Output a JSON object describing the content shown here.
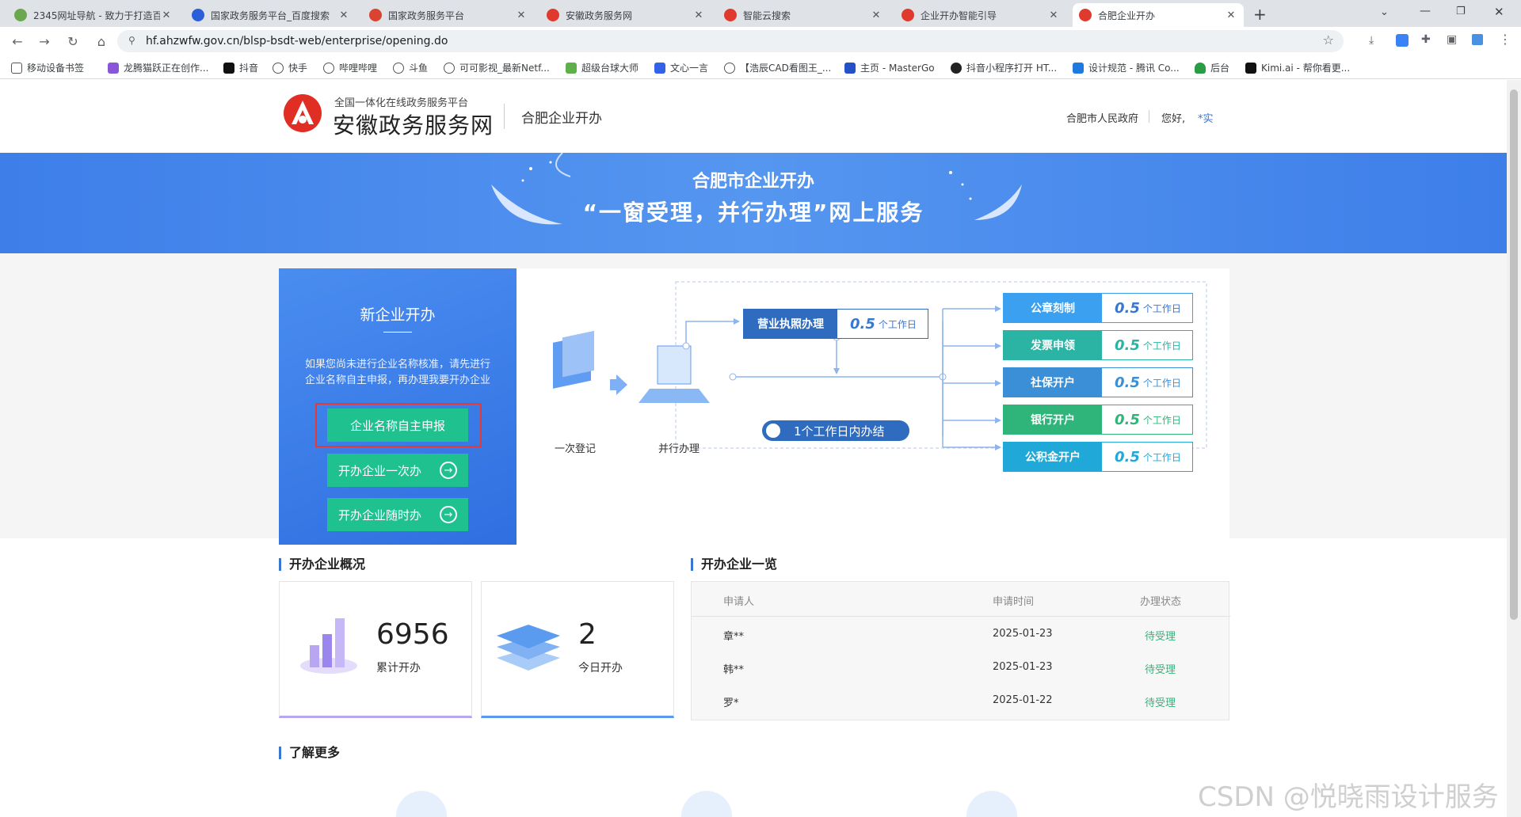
{
  "browser": {
    "tabs": [
      {
        "title": "2345网址导航 - 致力于打造百",
        "color": "#6aa84f"
      },
      {
        "title": "国家政务服务平台_百度搜索",
        "color": "#2b5fd9"
      },
      {
        "title": "国家政务服务平台",
        "color": "#d9432f"
      },
      {
        "title": "安徽政务服务网",
        "color": "#e03a2f"
      },
      {
        "title": "智能云搜索",
        "color": "#e03a2f"
      },
      {
        "title": "企业开办智能引导",
        "color": "#e03a2f"
      },
      {
        "title": "合肥企业开办",
        "color": "#e03a2f"
      }
    ],
    "url": "hf.ahzwfw.gov.cn/blsp-bsdt-web/enterprise/opening.do",
    "bookmarks": [
      "移动设备书签",
      "龙腾猫跃正在创作...",
      "抖音",
      "快手",
      "哔哩哔哩",
      "斗鱼",
      "可可影视_最新Netf...",
      "超级台球大师",
      "文心一言",
      "【浩辰CAD看图王_...",
      "主页 - MasterGo",
      "抖音小程序打开 HT...",
      "设计规范 - 腾讯 Co...",
      "后台",
      "Kimi.ai - 帮你看更..."
    ]
  },
  "header": {
    "logo_sub": "全国一体化在线政务服务平台",
    "logo_main": "安徽政务服务网",
    "site_name": "合肥企业开办",
    "gov_link": "合肥市人民政府",
    "greeting": "您好,",
    "user": "*实"
  },
  "banner": {
    "line1": "合肥市企业开办",
    "line2": "“一窗受理，并行办理”网上服务"
  },
  "panel": {
    "title": "新企业开办",
    "desc1": "如果您尚未进行企业名称核准，请先进行",
    "desc2": "企业名称自主申报，再办理我要开办企业",
    "btn_name": "企业名称自主申报",
    "btn_once": "开办企业一次办",
    "btn_anytime": "开办企业随时办"
  },
  "flow": {
    "step1": "一次登记",
    "step2": "并行办理",
    "license": {
      "label": "营业执照办理",
      "num": "0.5",
      "unit": "个工作日"
    },
    "done": "1个工作日内办结",
    "items": [
      {
        "label": "公章刻制",
        "num": "0.5",
        "unit": "个工作日",
        "color": "#3aa0ef"
      },
      {
        "label": "发票申领",
        "num": "0.5",
        "unit": "个工作日",
        "color": "#2bb3a3"
      },
      {
        "label": "社保开户",
        "num": "0.5",
        "unit": "个工作日",
        "color": "#3b8fd6"
      },
      {
        "label": "银行开户",
        "num": "0.5",
        "unit": "个工作日",
        "color": "#2fb57a"
      },
      {
        "label": "公积金开户",
        "num": "0.5",
        "unit": "个工作日",
        "color": "#1fa8d8"
      }
    ]
  },
  "overview": {
    "title": "开办企业概况",
    "total_value": "6956",
    "total_label": "累计开办",
    "today_value": "2",
    "today_label": "今日开办"
  },
  "list": {
    "title": "开办企业一览",
    "headers": [
      "申请人",
      "申请时间",
      "办理状态"
    ],
    "rows": [
      {
        "name": "章**",
        "date": "2025-01-23",
        "status": "待受理"
      },
      {
        "name": "韩**",
        "date": "2025-01-23",
        "status": "待受理"
      },
      {
        "name": "罗*",
        "date": "2025-01-22",
        "status": "待受理"
      }
    ]
  },
  "more_title": "了解更多",
  "watermark": "CSDN @悦晓雨设计服务"
}
